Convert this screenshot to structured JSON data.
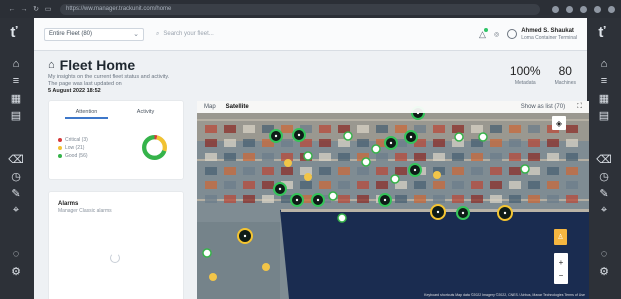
{
  "browser": {
    "url": "https://ww.manager.trackunit.com/home"
  },
  "topbar": {
    "fleet_selector": "Entire Fleet (80)",
    "search_placeholder": "Search your fleet...",
    "user_name": "Ahmed S. Shaukat",
    "user_role": "Loma Container Terminal"
  },
  "page": {
    "title": "Fleet Home",
    "subtitle_line1": "My insights on the current fleet status and activity.",
    "subtitle_line2": "The page was last updated on",
    "date": "5 August 2022 18:52",
    "kpis": [
      {
        "value": "100%",
        "label": "Metadata"
      },
      {
        "value": "80",
        "label": "Machines"
      }
    ]
  },
  "attention_card": {
    "tabs": [
      "Attention",
      "Activity"
    ],
    "statuses": [
      {
        "label": "Critical (3)",
        "color": "#d63a3a"
      },
      {
        "label": "Low (21)",
        "color": "#f1c232"
      },
      {
        "label": "Good (56)",
        "color": "#35b34a"
      }
    ],
    "donut": [
      {
        "value": 3,
        "color": "#d63a3a"
      },
      {
        "value": 21,
        "color": "#f1c232"
      },
      {
        "value": 56,
        "color": "#35b34a"
      }
    ]
  },
  "alarms_card": {
    "title": "Alarms",
    "subtitle": "Manager Classic alarms"
  },
  "map": {
    "mode_map": "Map",
    "mode_satellite": "Satellite",
    "show_list": "Show as list (70)",
    "credits": "Keyboard shortcuts   Map data ©2022 Imagery ©2022, CNES / Airbus, Maxar Technologies   Terms of Use"
  },
  "icons": {
    "left_rail": [
      "brand-icon",
      "home-icon",
      "list-icon",
      "calculator-icon",
      "document-icon",
      "trash-icon",
      "clock-icon",
      "wrench-icon",
      "pin-icon",
      "bell-icon",
      "settings-icon"
    ],
    "right_rail": [
      "brand-icon",
      "home-icon",
      "list-icon",
      "calculator-icon",
      "document-icon",
      "trash-icon",
      "clock-icon",
      "wrench-icon",
      "pin-icon",
      "bell-icon",
      "settings-icon"
    ]
  }
}
